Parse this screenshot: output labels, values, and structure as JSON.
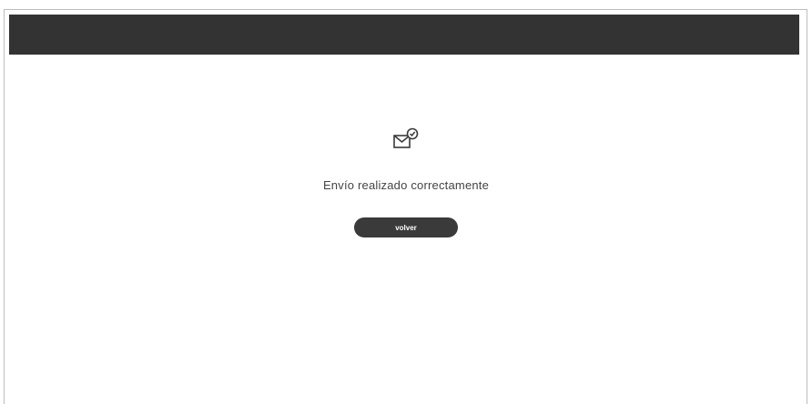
{
  "header": {
    "color": "#333333"
  },
  "confirmation": {
    "icon": "envelope-check-icon",
    "message": "Envío realizado correctamente",
    "button_label": "volver",
    "button_color": "#3a3a3a"
  }
}
